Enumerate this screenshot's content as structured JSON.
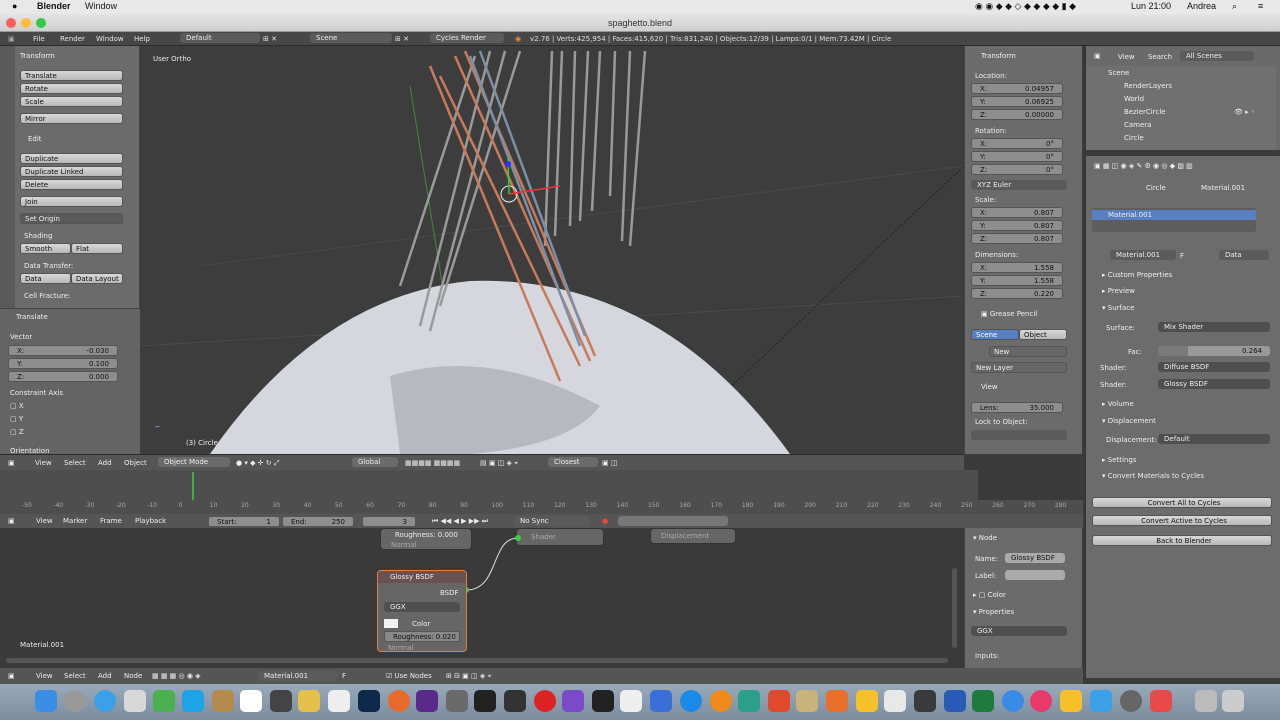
{
  "menubar": {
    "apple": "",
    "app": "Blender",
    "window": "Window",
    "clock": "Lun 21:00",
    "user": "Andrea"
  },
  "window_title": "spaghetto.blend",
  "info": {
    "menus": [
      "File",
      "Render",
      "Window",
      "Help"
    ],
    "layout": "Default",
    "scene": "Scene",
    "engine": "Cycles Render",
    "stats": "v2.76 | Verts:425,954 | Faces:415,620 | Tris:831,240 | Objects:12/39 | Lamps:0/1 | Mem:73.42M | Circle"
  },
  "toolshelf": {
    "transform_header": "Transform",
    "translate": "Translate",
    "rotate": "Rotate",
    "scale": "Scale",
    "mirror": "Mirror",
    "edit_header": "Edit",
    "duplicate": "Duplicate",
    "duplicate_linked": "Duplicate Linked",
    "delete": "Delete",
    "join": "Join",
    "set_origin": "Set Origin",
    "shading": "Shading",
    "smooth": "Smooth",
    "flat": "Flat",
    "data_transfer": "Data Transfer:",
    "data": "Data",
    "data_layout": "Data Layout",
    "cell_fracture": "Cell Fracture:",
    "op_header": "Translate",
    "vector": "Vector",
    "vx": "X:",
    "vy": "Y:",
    "vz": "Z:",
    "vxv": "-0.030",
    "vyv": "0.100",
    "vzv": "0.000",
    "constraint_axis": "Constraint Axis",
    "cx": "X",
    "cy": "Y",
    "cz": "Z",
    "orientation": "Orientation"
  },
  "viewport": {
    "label": "User Ortho",
    "object_label": "(3) Circle"
  },
  "vpheader": {
    "view": "View",
    "select": "Select",
    "add": "Add",
    "object": "Object",
    "mode": "Object Mode",
    "orientation": "Global",
    "pivot": "Closest"
  },
  "npanel": {
    "transform": "Transform",
    "location": "Location:",
    "lx": "X:",
    "lxv": "0.04957",
    "ly": "Y:",
    "lyv": "0.06925",
    "lz": "Z:",
    "lzv": "0.00000",
    "rotation": "Rotation:",
    "rx": "X:",
    "rxv": "0°",
    "ry": "Y:",
    "ryv": "0°",
    "rz": "Z:",
    "rzv": "0°",
    "rotmode": "XYZ Euler",
    "scale": "Scale:",
    "sx": "X:",
    "sxv": "0.807",
    "sy": "Y:",
    "syv": "0.807",
    "sz": "Z:",
    "szv": "0.807",
    "dimensions": "Dimensions:",
    "dx": "X:",
    "dxv": "1.558",
    "dy": "Y:",
    "dyv": "1.558",
    "dz": "Z:",
    "dzv": "0.220",
    "grease": "Grease Pencil",
    "scene": "Scene",
    "object": "Object",
    "new": "New",
    "new_layer": "New Layer",
    "view": "View",
    "lens": "Lens:",
    "lensv": "35.000",
    "lock": "Lock to Object:"
  },
  "outliner": {
    "view": "View",
    "search": "Search",
    "filter": "All Scenes",
    "items": [
      "Scene",
      "RenderLayers",
      "World",
      "BezierCircle",
      "Camera",
      "Circle"
    ]
  },
  "props": {
    "circle": "Circle",
    "material": "Material.001",
    "slot": "Material.001",
    "mat_name": "Material.001",
    "f": "F",
    "data": "Data",
    "custom": "Custom Properties",
    "preview": "Preview",
    "surface": "Surface",
    "surface_lbl": "Surface:",
    "surface_val": "Mix Shader",
    "fac": "Fac:",
    "fac_val": "0.264",
    "shader1_lbl": "Shader:",
    "shader1": "Diffuse BSDF",
    "shader2_lbl": "Shader:",
    "shader2": "Glossy BSDF",
    "volume": "Volume",
    "displacement": "Displacement",
    "disp_lbl": "Displacement:",
    "disp_val": "Default",
    "settings": "Settings",
    "convert": "Convert Materials to Cycles",
    "convert_all": "Convert All to Cycles",
    "convert_active": "Convert Active to Cycles",
    "back": "Back to Blender"
  },
  "timeline": {
    "ticks": [
      "-50",
      "-40",
      "-30",
      "-20",
      "-10",
      "0",
      "10",
      "20",
      "30",
      "40",
      "50",
      "60",
      "70",
      "80",
      "90",
      "100",
      "110",
      "120",
      "130",
      "140",
      "150",
      "160",
      "170",
      "180",
      "190",
      "200",
      "210",
      "220",
      "230",
      "240",
      "250",
      "260",
      "270",
      "280"
    ],
    "view": "View",
    "marker": "Marker",
    "frame": "Frame",
    "playback": "Playback",
    "start": "Start:",
    "start_val": "1",
    "end": "End:",
    "end_val": "250",
    "current": "3",
    "sync": "No Sync"
  },
  "nodeeditor": {
    "roughness_top": "Roughness: 0.000",
    "normal_top": "Normal",
    "shader": "Shader",
    "displacement": "Displacement",
    "glossy_title": "Glossy BSDF",
    "bsdf": "BSDF",
    "ggx": "GGX",
    "color": "Color",
    "roughness": "Roughness: 0.020",
    "normal": "Normal",
    "material": "Material.001"
  },
  "nodepanel": {
    "node": "Node",
    "name": "Name:",
    "name_val": "Glossy BSDF",
    "label": "Label:",
    "color": "Color",
    "properties": "Properties",
    "ggx": "GGX",
    "inputs": "Inputs:"
  },
  "nodeheader": {
    "view": "View",
    "select": "Select",
    "add": "Add",
    "node": "Node",
    "material": "Material.001",
    "f": "F",
    "use_nodes": "Use Nodes"
  }
}
